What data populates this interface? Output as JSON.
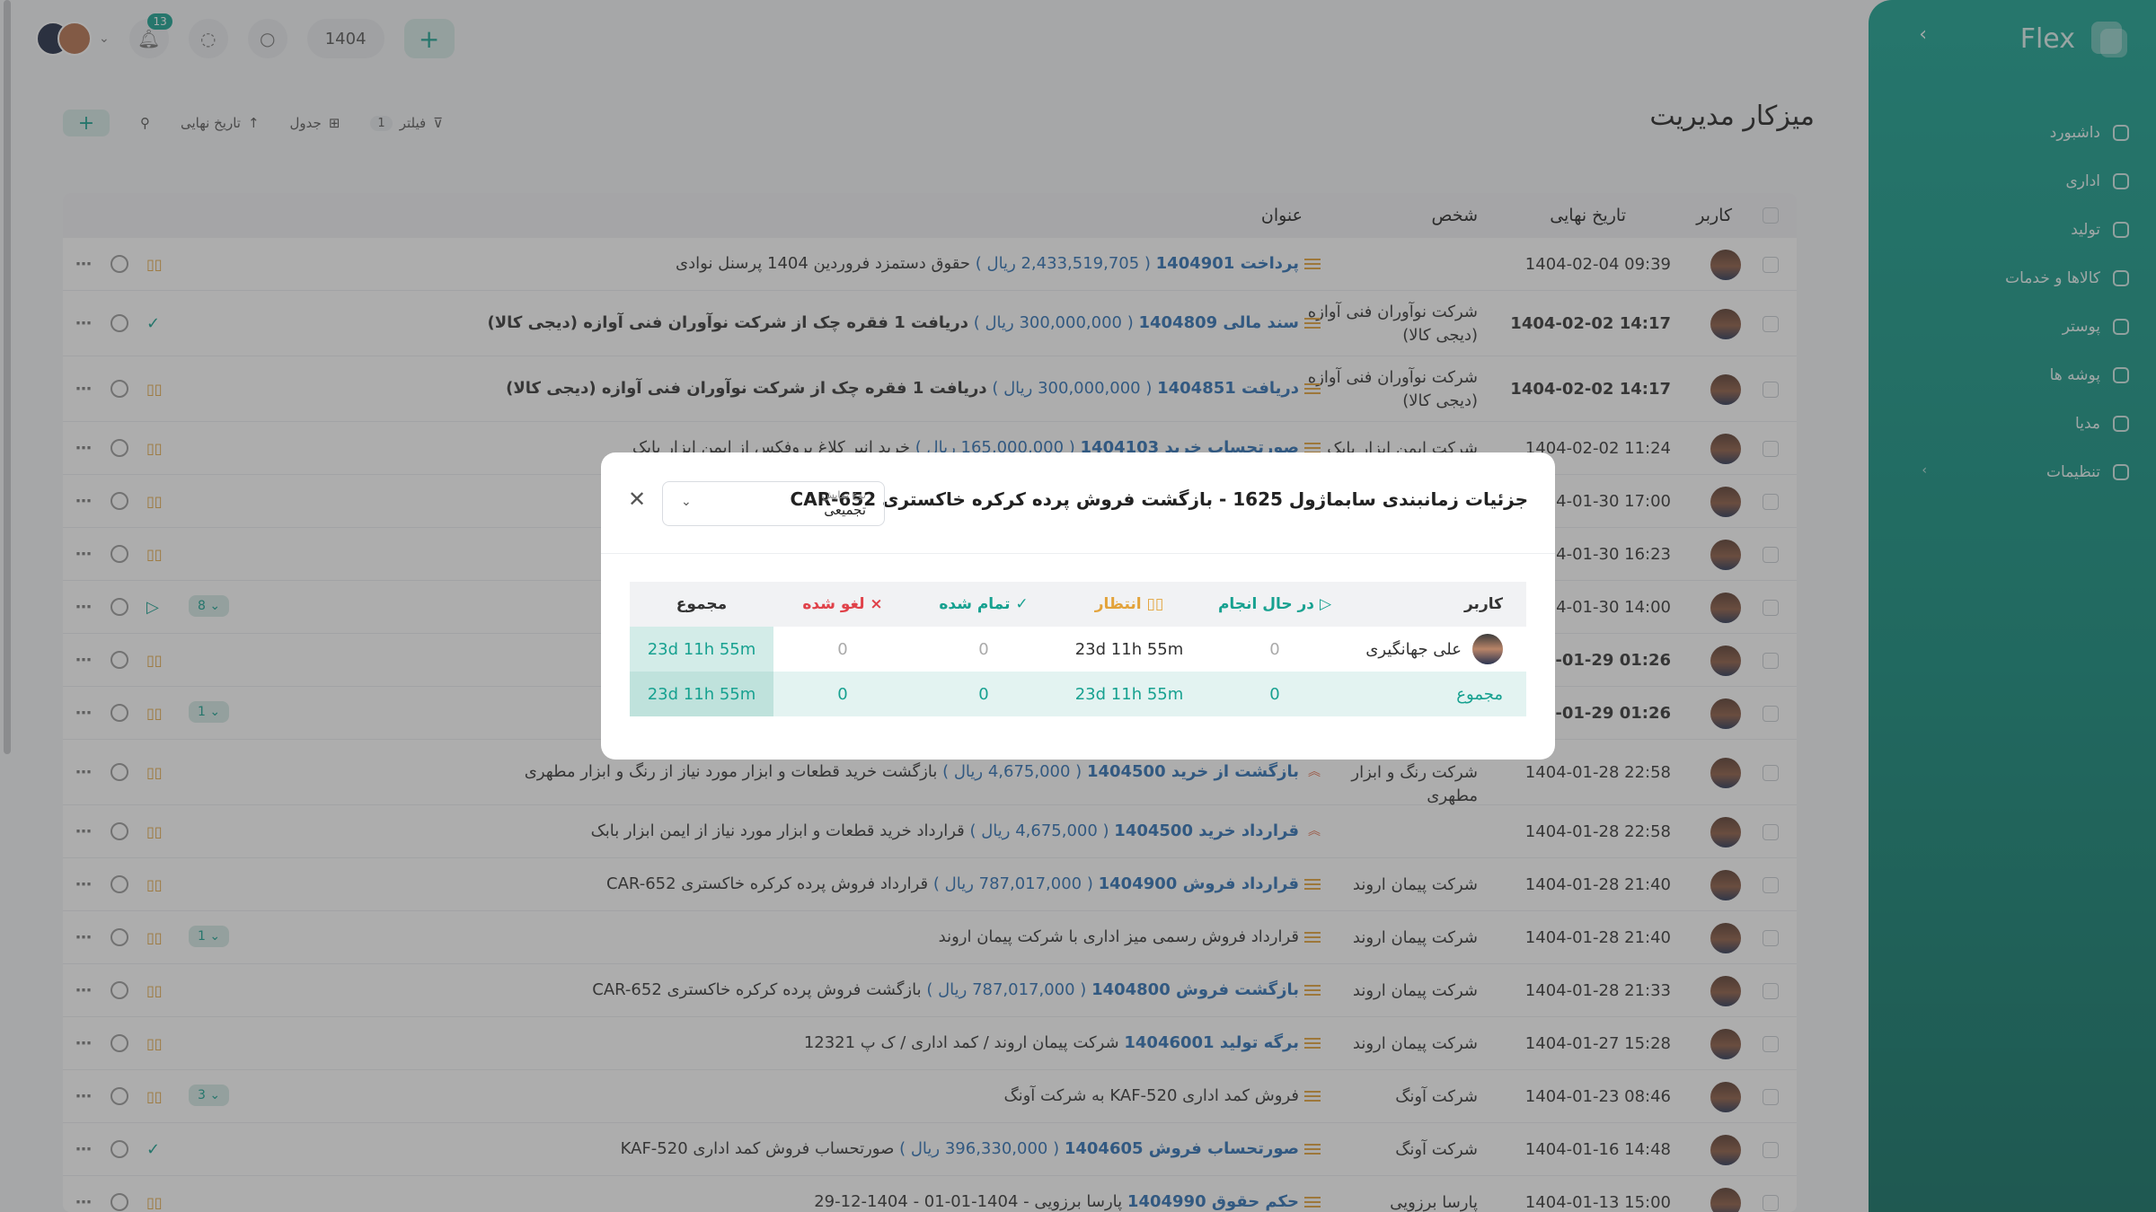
{
  "sidebar": {
    "brand": "Flex",
    "items": [
      {
        "label": "داشبورد",
        "icon": "home-icon"
      },
      {
        "label": "اداری",
        "icon": "briefcase-icon"
      },
      {
        "label": "تولید",
        "icon": "factory-icon"
      },
      {
        "label": "کالاها و خدمات",
        "icon": "box-icon"
      },
      {
        "label": "پوستر",
        "icon": "image-icon"
      },
      {
        "label": "پوشه ها",
        "icon": "folder-icon"
      },
      {
        "label": "مدیا",
        "icon": "media-icon"
      },
      {
        "label": "تنظیمات",
        "icon": "gear-icon"
      }
    ]
  },
  "topbar": {
    "notifications": "13",
    "year": "1404"
  },
  "page": {
    "title": "میزکار مدیریت"
  },
  "toolbar": {
    "filter": "فیلتر",
    "filter_count": "1",
    "view": "جدول",
    "sort": "تاریخ نهایی"
  },
  "table": {
    "headers": {
      "user": "کاربر",
      "due": "تاریخ نهایی",
      "person": "شخص",
      "title": "عنوان"
    },
    "rows": [
      {
        "date": "1404-02-04 09:39",
        "person": "",
        "link": "پرداخت 1404901",
        "amount": "( 2,433,519,705 ریال )",
        "text": "حقوق دستمزد فروردین 1404 پرسنل نوادی",
        "bold": false,
        "state": "pause",
        "sub": ""
      },
      {
        "date": "1404-02-02 14:17",
        "person": "شرکت نوآوران فنی آوازه (دیجی کالا)",
        "link": "سند مالی 1404809",
        "amount": "( 300,000,000 ریال )",
        "text": "دریافت 1 فقره چک از شرکت نوآوران فنی آوازه (دیجی کالا)",
        "bold": true,
        "state": "check",
        "sub": ""
      },
      {
        "date": "1404-02-02 14:17",
        "person": "شرکت نوآوران فنی آوازه (دیجی کالا)",
        "link": "دریافت 1404851",
        "amount": "( 300,000,000 ریال )",
        "text": "دریافت 1 فقره چک از شرکت نوآوران فنی آوازه (دیجی کالا)",
        "bold": true,
        "state": "pause",
        "sub": ""
      },
      {
        "date": "1404-02-02 11:24",
        "person": "شرکت ایمن ابزار بابک",
        "link": "صورتحساب خرید 1404103",
        "amount": "( 165,000,000 ریال )",
        "text": "خرید انبر کلاغ پروفکس از ایمن ابزار بابک",
        "bold": false,
        "state": "pause",
        "sub": ""
      },
      {
        "date": "1404-01-30 17:00",
        "person": "",
        "link": "",
        "amount": "",
        "text": "",
        "bold": false,
        "state": "pause",
        "sub": ""
      },
      {
        "date": "1404-01-30 16:23",
        "person": "",
        "link": "",
        "amount": "",
        "text": "",
        "bold": false,
        "state": "pause",
        "sub": ""
      },
      {
        "date": "1404-01-30 14:00",
        "person": "",
        "link": "",
        "amount": "",
        "text": "",
        "bold": false,
        "state": "play",
        "sub": "8"
      },
      {
        "date": "1404-01-29 01:26",
        "person": "",
        "link": "",
        "amount": "",
        "text": "",
        "bold": true,
        "state": "pause",
        "sub": ""
      },
      {
        "date": "1404-01-29 01:26",
        "person": "",
        "link": "",
        "amount": "",
        "text": "",
        "bold": true,
        "state": "pause",
        "sub": "1"
      },
      {
        "date": "1404-01-28 22:58",
        "person": "شرکت رنگ و ابزار مطهری",
        "link": "بازگشت از خرید 1404500",
        "amount": "( 4,675,000 ریال )",
        "text": "بازگشت خرید قطعات و ابزار مورد نیاز از رنگ و ابزار مطهری",
        "bold": false,
        "state": "pause",
        "sub": "",
        "up": true
      },
      {
        "date": "1404-01-28 22:58",
        "person": "",
        "link": "قرارداد خرید 1404500",
        "amount": "( 4,675,000 ریال )",
        "text": "قرارداد خرید قطعات و ابزار مورد نیاز از ایمن ابزار بابک",
        "bold": false,
        "state": "pause",
        "sub": "",
        "up": true
      },
      {
        "date": "1404-01-28 21:40",
        "person": "شرکت پیمان اروند",
        "link": "قرارداد فروش 1404900",
        "amount": "( 787,017,000 ریال )",
        "text": "قرارداد فروش پرده کرکره خاکستری CAR-652",
        "bold": false,
        "state": "pause",
        "sub": ""
      },
      {
        "date": "1404-01-28 21:40",
        "person": "شرکت پیمان اروند",
        "link": "",
        "amount": "",
        "text": "قرارداد فروش رسمی میز اداری با شرکت پیمان اروند",
        "bold": false,
        "state": "pause",
        "sub": "1"
      },
      {
        "date": "1404-01-28 21:33",
        "person": "شرکت پیمان اروند",
        "link": "بازگشت فروش 1404800",
        "amount": "( 787,017,000 ریال )",
        "text": "بازگشت فروش پرده کرکره خاکستری CAR-652",
        "bold": false,
        "state": "pause",
        "sub": ""
      },
      {
        "date": "1404-01-27 15:28",
        "person": "شرکت پیمان اروند",
        "link": "برگه تولید 14046001",
        "amount": "",
        "text": "شرکت پیمان اروند / کمد اداری / ک پ 12321",
        "bold": false,
        "state": "pause",
        "sub": ""
      },
      {
        "date": "1404-01-23 08:46",
        "person": "شرکت آونگ",
        "link": "",
        "amount": "",
        "text": "فروش کمد اداری KAF-520 به شرکت آونگ",
        "bold": false,
        "state": "pause",
        "sub": "3"
      },
      {
        "date": "1404-01-16 14:48",
        "person": "شرکت آونگ",
        "link": "صورتحساب فروش 1404605",
        "amount": "( 396,330,000 ریال )",
        "text": "صورتحساب فروش کمد اداری KAF-520",
        "bold": false,
        "state": "check",
        "sub": ""
      },
      {
        "date": "1404-01-13 15:00",
        "person": "پارسا برزویی",
        "link": "حکم حقوق 1404990",
        "amount": "",
        "text": "پارسا برزویی - 1404-01-01 - 1404-12-29",
        "bold": false,
        "state": "pause",
        "sub": ""
      }
    ]
  },
  "modal": {
    "title": "جزئیات زمانبندی سابماژول 1625 - بازگشت فروش پرده کرکره خاکستری CAR-652",
    "select_label": "نوع نمایش",
    "select_value": "تجمیعی",
    "headers": {
      "user": "کاربر",
      "in_progress": "در حال انجام",
      "waiting": "انتظار",
      "done": "تمام شده",
      "cancelled": "لغو شده",
      "total": "مجموع"
    },
    "rows": [
      {
        "user": "علی جهانگیری",
        "in_progress": "0",
        "waiting": "23d 11h 55m",
        "done": "0",
        "cancelled": "0",
        "total": "23d 11h 55m"
      }
    ],
    "summary": {
      "label": "مجموع",
      "in_progress": "0",
      "waiting": "23d 11h 55m",
      "done": "0",
      "cancelled": "0",
      "total": "23d 11h 55m"
    }
  }
}
